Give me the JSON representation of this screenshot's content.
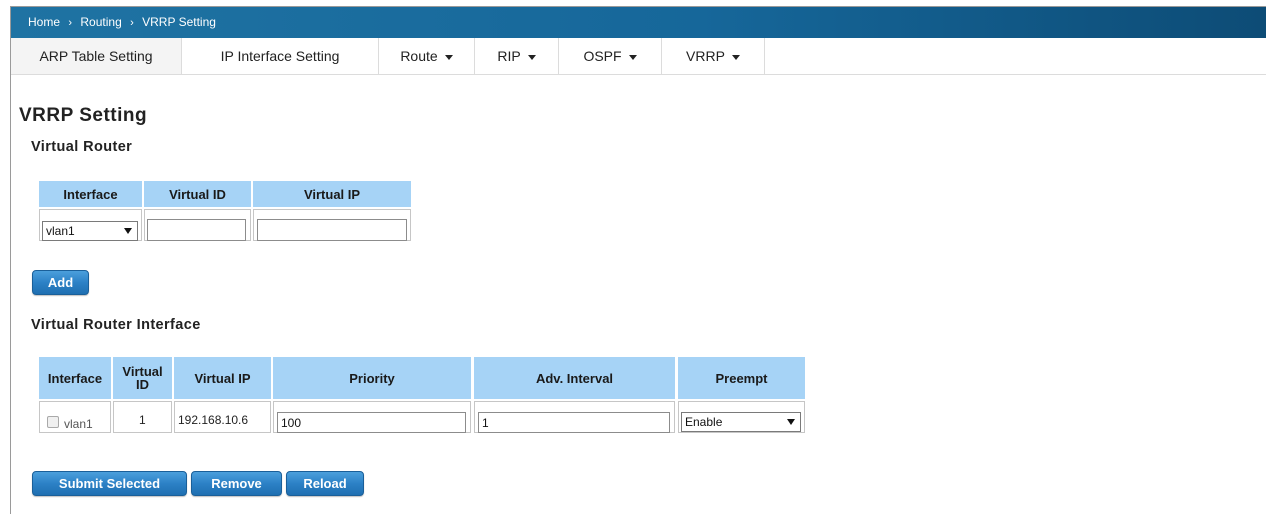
{
  "breadcrumb": {
    "home": "Home",
    "sep": "›",
    "routing": "Routing",
    "current": "VRRP Setting"
  },
  "tabs": [
    {
      "label": "ARP Table Setting"
    },
    {
      "label": "IP Interface Setting"
    },
    {
      "label": "Route"
    },
    {
      "label": "RIP"
    },
    {
      "label": "OSPF"
    },
    {
      "label": "VRRP"
    }
  ],
  "page_title": "VRRP Setting",
  "virtual_router": {
    "title": "Virtual Router",
    "headers": {
      "interface": "Interface",
      "virtual_id": "Virtual ID",
      "virtual_ip": "Virtual IP"
    },
    "interface_value": "vlan1",
    "virtual_id_value": "",
    "virtual_ip_value": "",
    "add_label": "Add"
  },
  "vr_interface": {
    "title": "Virtual Router Interface",
    "headers": {
      "interface": "Interface",
      "virtual_id_1": "Virtual",
      "virtual_id_2": "ID",
      "virtual_ip": "Virtual IP",
      "priority": "Priority",
      "adv_interval": "Adv. Interval",
      "preempt": "Preempt"
    },
    "row": {
      "interface": "vlan1",
      "virtual_id": "1",
      "virtual_ip": "192.168.10.6",
      "priority": "100",
      "adv_interval": "1",
      "preempt": "Enable"
    }
  },
  "buttons": {
    "submit": "Submit Selected",
    "remove": "Remove",
    "reload": "Reload"
  },
  "colors": {
    "header_bg": "#a6d3f6",
    "button_blue": "#2c81c6",
    "breadcrumb_bar": "#16679a"
  }
}
